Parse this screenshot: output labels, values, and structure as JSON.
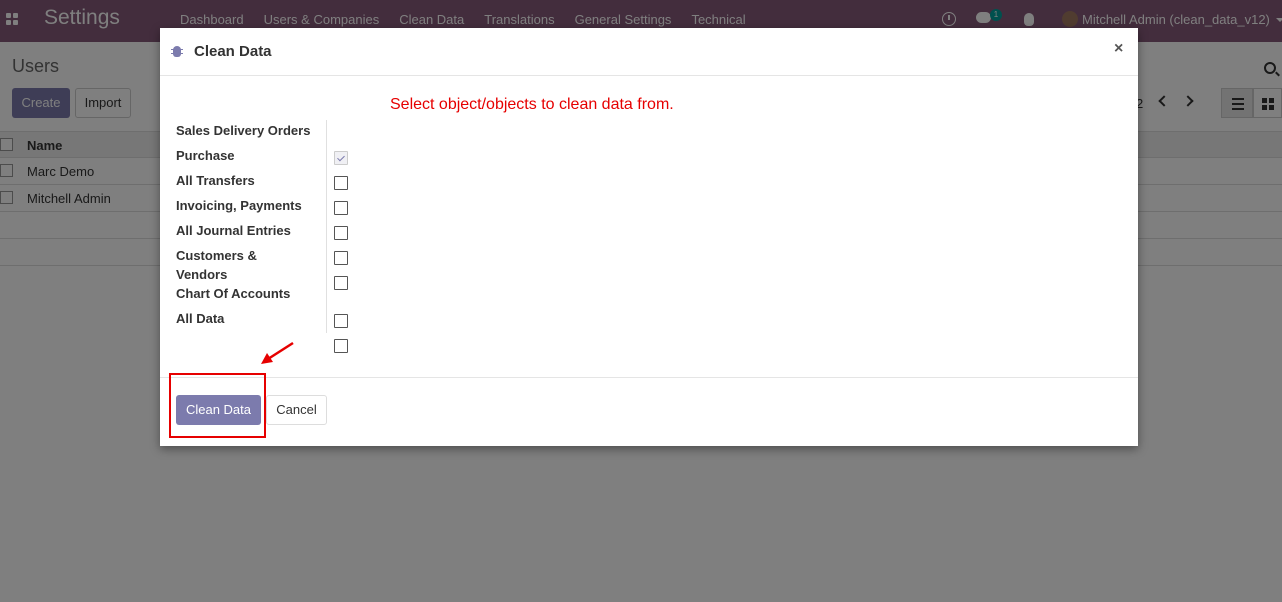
{
  "navbar": {
    "brand": "Settings",
    "menu": [
      "Dashboard",
      "Users & Companies",
      "Clean Data",
      "Translations",
      "General Settings",
      "Technical"
    ],
    "chat_count": "1",
    "user": "Mitchell Admin (clean_data_v12)"
  },
  "control_panel": {
    "title": "Users",
    "create_label": "Create",
    "import_label": "Import",
    "pager_value": "2"
  },
  "list": {
    "column_name": "Name",
    "rows": [
      "Marc Demo",
      "Mitchell Admin"
    ]
  },
  "dialog": {
    "title": "Clean Data",
    "close_glyph": "×",
    "instruction": "Select object/objects to clean data from.",
    "options": [
      {
        "label": "Sales Delivery Orders",
        "checked": true
      },
      {
        "label": "Purchase",
        "checked": false
      },
      {
        "label": "All Transfers",
        "checked": false
      },
      {
        "label": "Invoicing, Payments",
        "checked": false
      },
      {
        "label": "All Journal Entries",
        "checked": false
      },
      {
        "label": "Customers & Vendors",
        "checked": false
      },
      {
        "label": "Chart Of Accounts",
        "checked": false
      },
      {
        "label": "All Data",
        "checked": false
      }
    ],
    "clean_button": "Clean Data",
    "cancel_button": "Cancel"
  },
  "colors": {
    "navbar": "#875a7b",
    "primary": "#7c7bad",
    "annotation": "#e60000"
  },
  "icons": [
    "apps-icon",
    "clock-icon",
    "chat-icon",
    "bug-icon",
    "search-icon",
    "chevron-left-icon",
    "chevron-right-icon",
    "list-view-icon",
    "kanban-view-icon",
    "close-icon",
    "arrow-icon"
  ]
}
